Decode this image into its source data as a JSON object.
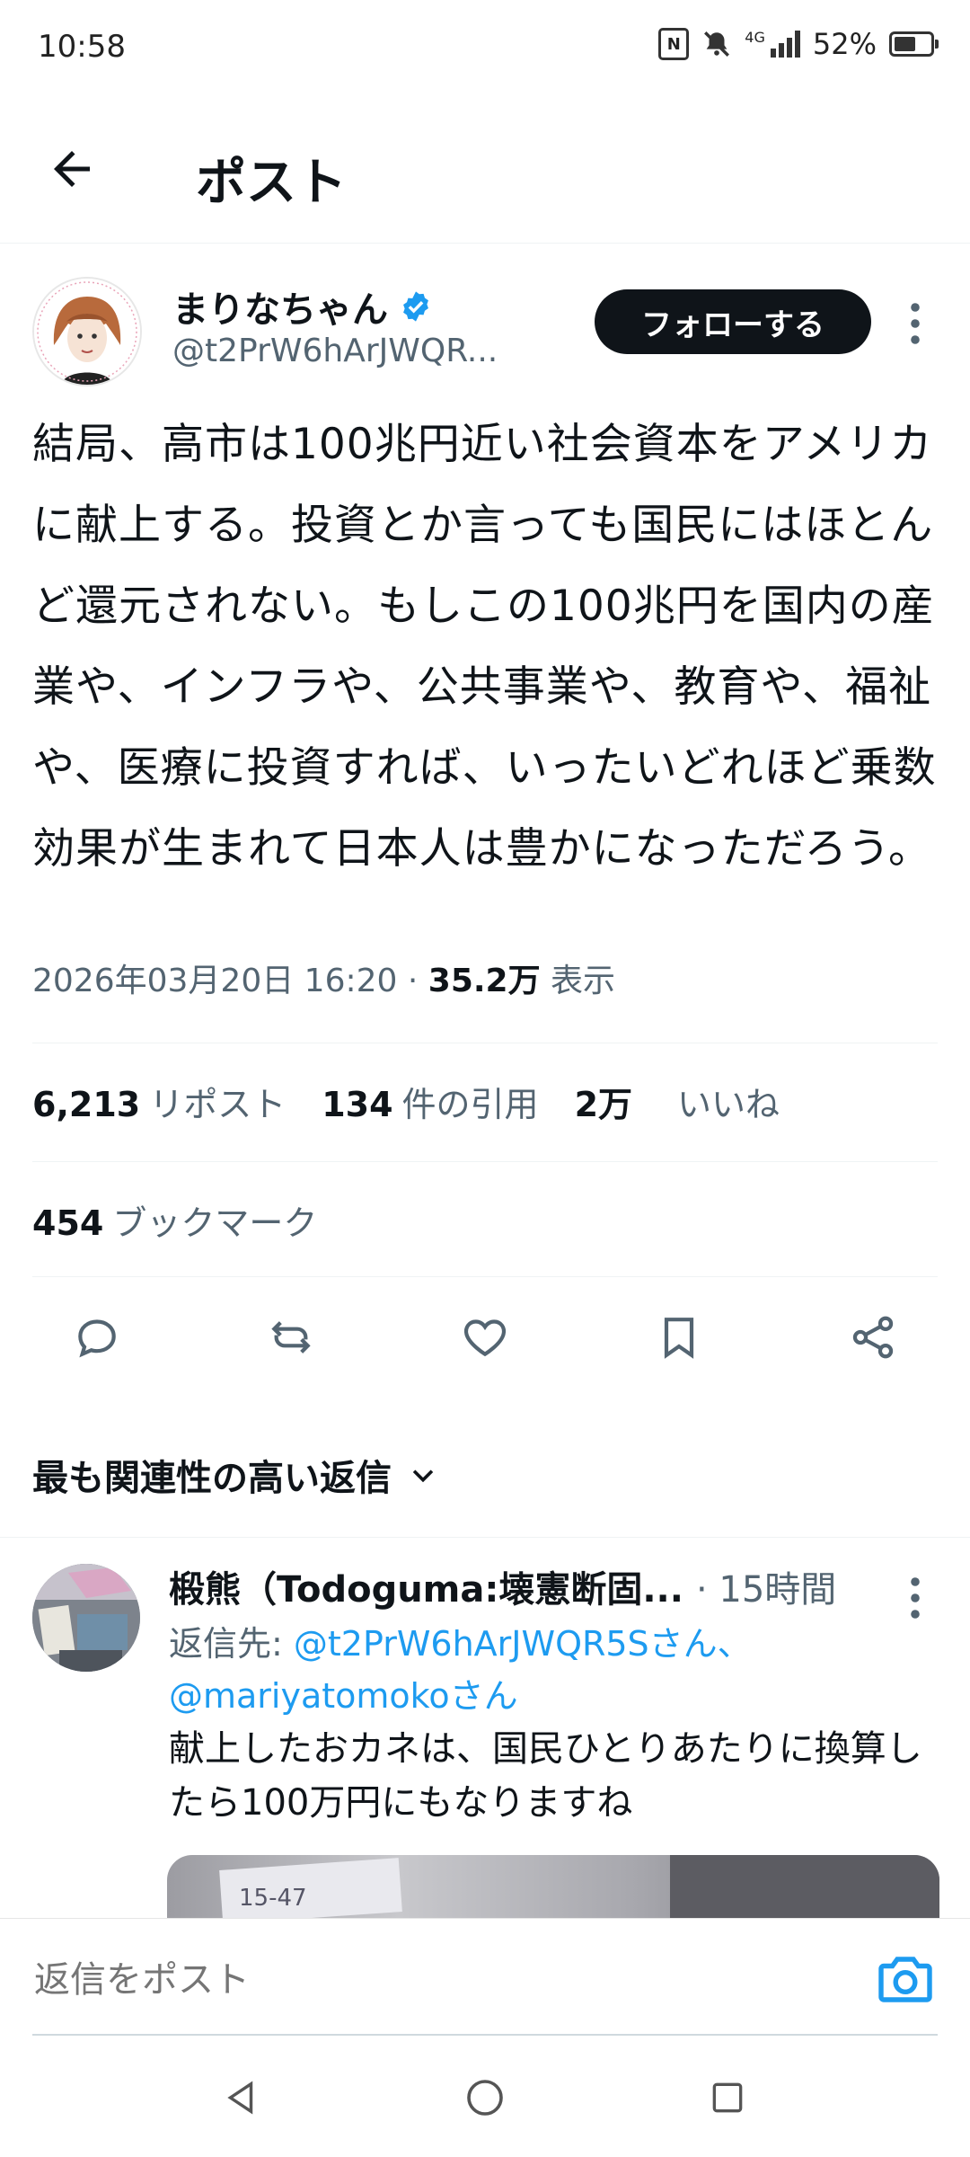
{
  "status_bar": {
    "time": "10:58",
    "network": "4G",
    "battery": "52%",
    "battery_level": 0.52
  },
  "header": {
    "title": "ポスト"
  },
  "post": {
    "author_name": "まりなちゃん",
    "author_handle": "@t2PrW6hArJWQR...",
    "follow_label": "フォローする",
    "body": "結局、高市は100兆円近い社会資本をアメリカに献上する。投資とか言っても国民にはほとんど還元されない。もしこの100兆円を国内の産業や、インフラや、公共事業や、教育や、福祉や、医療に投資すれば、いったいどれほど乗数効果が生まれて日本人は豊かになっただろう。",
    "timestamp": "2026年03月20日 16:20 · ",
    "views_count": "35.2万",
    "views_label": " 表示"
  },
  "stats": {
    "reposts_count": "6,213",
    "reposts_label": "リポスト",
    "quotes_count": "134",
    "quotes_label": "件の引用",
    "likes_count": "2万",
    "likes_label": "いいね",
    "bookmarks_count": "454",
    "bookmarks_label": "ブックマーク"
  },
  "sort": {
    "label": "最も関連性の高い返信"
  },
  "reply": {
    "author_name": "椴熊（Todoguma:壊憲断固...",
    "time": "· 15時間",
    "reply_to_prefix": "返信先: ",
    "reply_to_1": "@t2PrW6hArJWQR5Sさん、",
    "reply_to_2": "@mariyatomokoさん",
    "text": "献上したおカネは、国民ひとりあたりに換算したら100万円にもなりますね"
  },
  "compose": {
    "placeholder": "返信をポスト"
  },
  "colors": {
    "accent": "#1d9bf0",
    "text": "#0f1419",
    "muted": "#536471"
  }
}
